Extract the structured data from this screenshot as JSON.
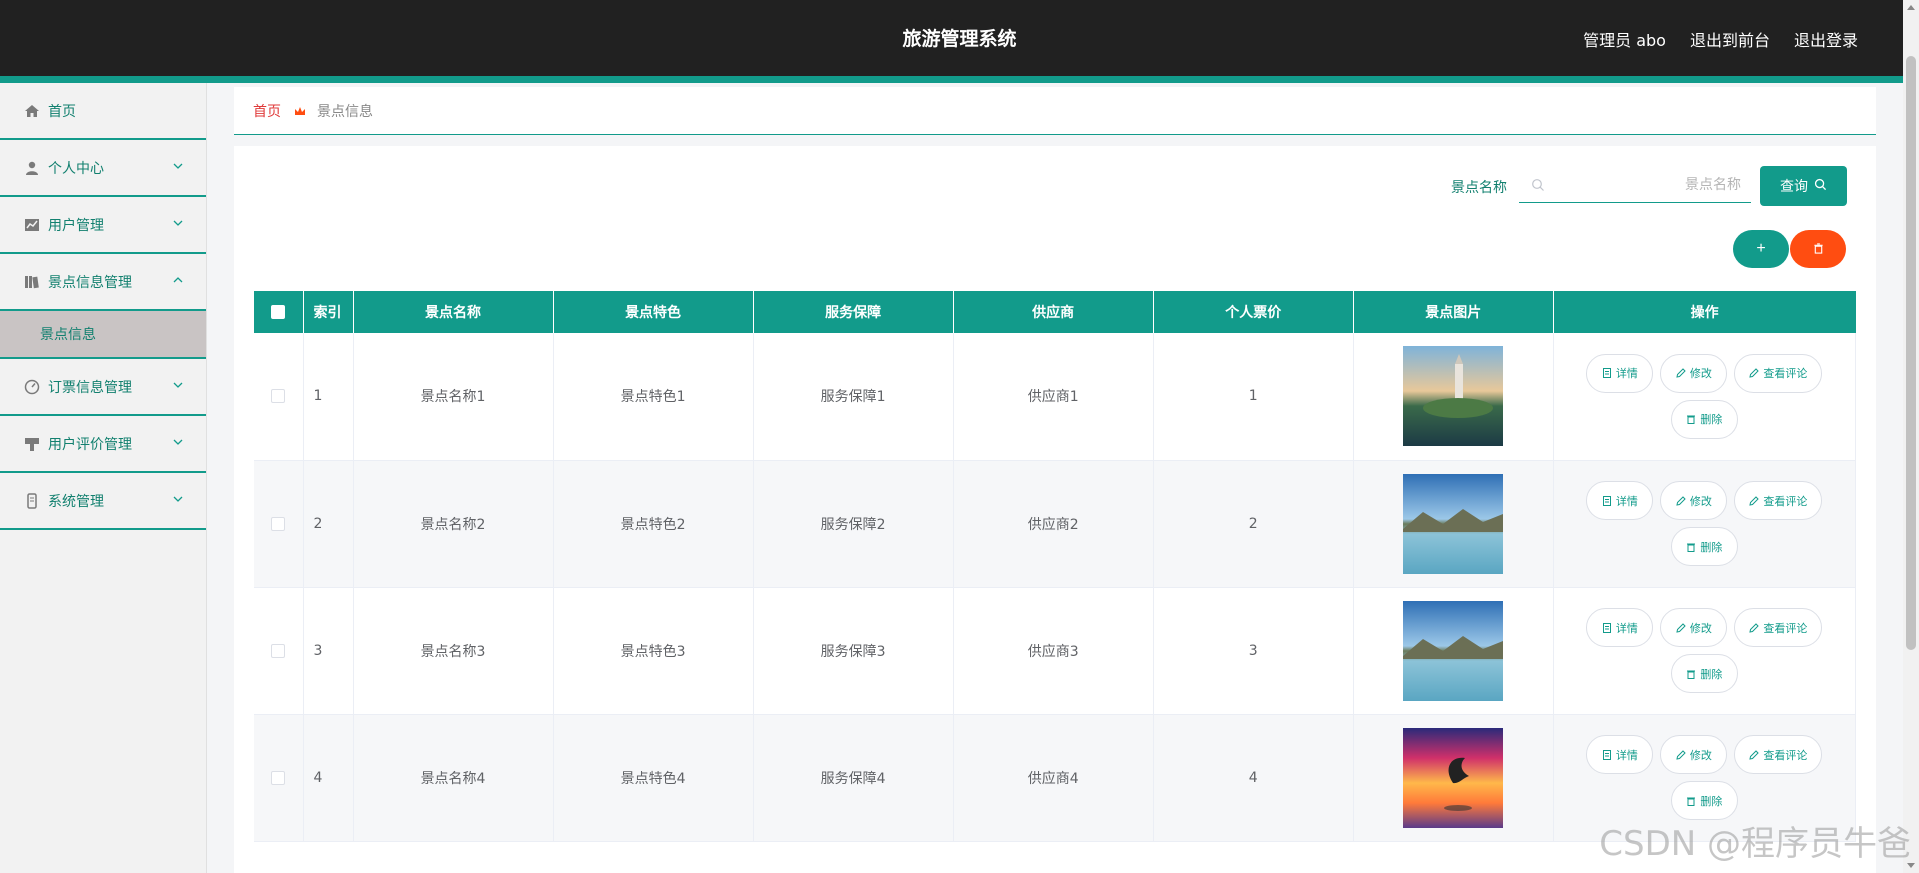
{
  "header": {
    "title": "旅游管理系统",
    "admin_label": "管理员 abo",
    "front_label": "退出到前台",
    "logout_label": "退出登录"
  },
  "sidebar": {
    "items": [
      {
        "label": "首页",
        "icon": "home-icon"
      },
      {
        "label": "个人中心",
        "icon": "user-icon"
      },
      {
        "label": "用户管理",
        "icon": "chart-icon"
      },
      {
        "label": "景点信息管理",
        "icon": "book-icon"
      },
      {
        "label": "订票信息管理",
        "icon": "gauge-icon"
      },
      {
        "label": "用户评价管理",
        "icon": "hammer-icon"
      },
      {
        "label": "系统管理",
        "icon": "phone-icon"
      }
    ],
    "subitem": {
      "label": "景点信息"
    }
  },
  "breadcrumb": {
    "home": "首页",
    "current": "景点信息"
  },
  "search": {
    "label": "景点名称",
    "placeholder": "景点名称",
    "value": "",
    "button_label": "查询"
  },
  "actions": {
    "add_label": "+"
  },
  "table": {
    "headers": [
      "索引",
      "景点名称",
      "景点特色",
      "服务保障",
      "供应商",
      "个人票价",
      "景点图片",
      "操作"
    ],
    "rows": [
      {
        "idx": "1",
        "name": "景点名称1",
        "feature": "景点特色1",
        "service": "服务保障1",
        "supplier": "供应商1",
        "price": "1"
      },
      {
        "idx": "2",
        "name": "景点名称2",
        "feature": "景点特色2",
        "service": "服务保障2",
        "supplier": "供应商2",
        "price": "2"
      },
      {
        "idx": "3",
        "name": "景点名称3",
        "feature": "景点特色3",
        "service": "服务保障3",
        "supplier": "供应商3",
        "price": "3"
      },
      {
        "idx": "4",
        "name": "景点名称4",
        "feature": "景点特色4",
        "service": "服务保障4",
        "supplier": "供应商4",
        "price": "4"
      }
    ],
    "op_labels": {
      "detail": "详情",
      "edit": "修改",
      "comment": "查看评论",
      "delete": "删除"
    }
  },
  "watermark": "CSDN @程序员牛爸",
  "colors": {
    "primary": "#129b8b",
    "danger": "#ff4d11",
    "topbar": "#212121"
  }
}
